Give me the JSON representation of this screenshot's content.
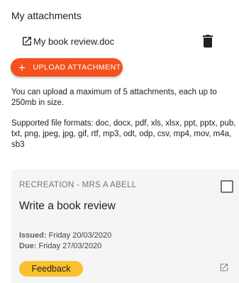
{
  "attachments": {
    "title": "My attachments",
    "files": [
      {
        "name": "My book review.doc",
        "open_icon": "open-in-new-icon",
        "delete_icon": "trash-icon"
      }
    ],
    "upload_button": {
      "icon": "plus-icon",
      "label": "UPLOAD ATTACHMENT",
      "color": "#f4511e"
    },
    "limit_text": "You can upload a maximum of 5 attachments, each up to 250mb in size.",
    "formats_text": "Supported file formats: doc, docx, pdf, xls, xlsx, ppt, pptx, pub, txt, png, jpeg, jpg, gif, rtf, mp3, odt, odp, csv, mp4, mov, m4a, sb3"
  },
  "task_card": {
    "subject": "RECREATION - MRS A ABELL",
    "title": "Write a book review",
    "issued_label": "Issued:",
    "issued_date": "Friday 20/03/2020",
    "due_label": "Due:",
    "due_date": "Friday 27/03/2020",
    "feedback_label": "Feedback",
    "feedback_color": "#fbc02d",
    "checkbox_checked": false,
    "open_icon": "open-in-new-icon"
  }
}
